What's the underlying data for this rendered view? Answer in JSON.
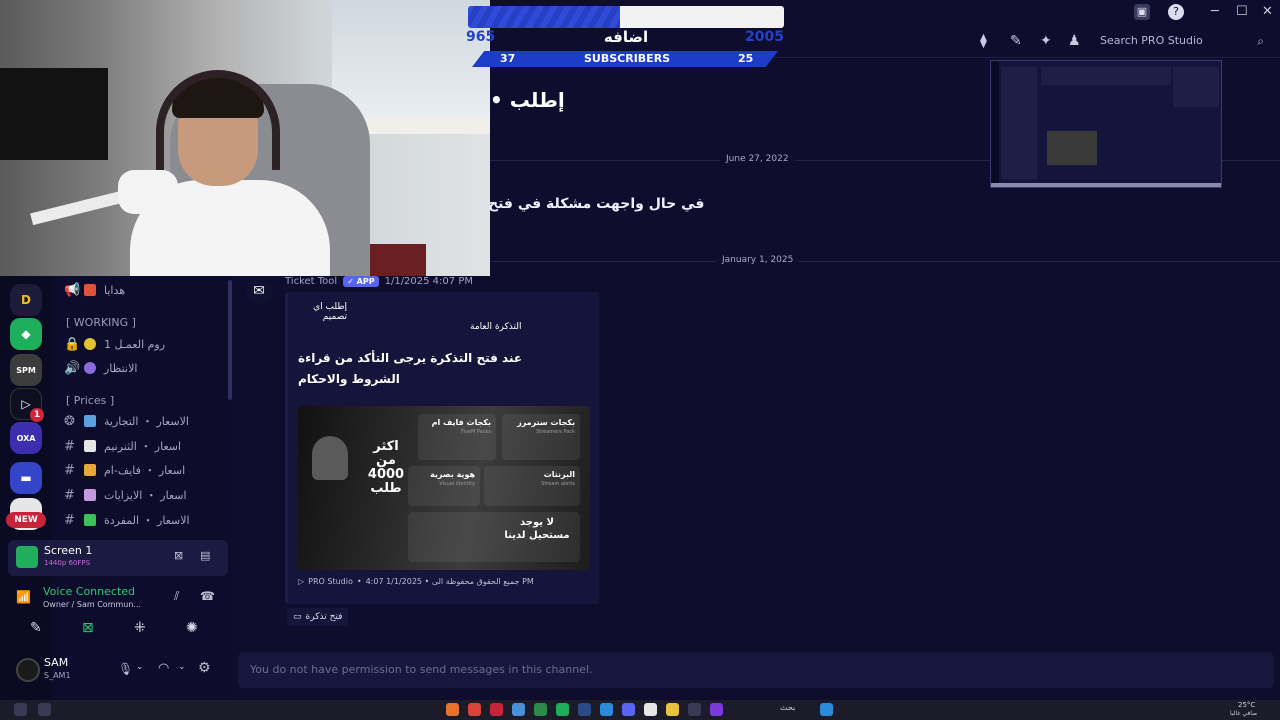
{
  "window": {
    "search_placeholder": "Search PRO Studio",
    "controls": [
      "─",
      "☐",
      "✕"
    ]
  },
  "subscriber_widget": {
    "left_count": "965",
    "right_count": "2005",
    "title": "اضافه",
    "band_left": "37",
    "band_center": "SUBSCRIBERS",
    "band_right": "25",
    "progress_fraction": 0.48,
    "fill_color": "#2f4bd8"
  },
  "servers": [
    {
      "icon": "D",
      "color": "#1d1b3a"
    },
    {
      "icon": "◆",
      "color": "#1fae5b"
    },
    {
      "icon": "SPM",
      "color": "#3c3c3c"
    },
    {
      "icon": "▷",
      "color": "#0f0f22",
      "badge": "1"
    },
    {
      "icon": "OXA",
      "color": "#3b2fb0"
    },
    {
      "icon": "▬",
      "color": "#3445c9"
    },
    {
      "icon": "",
      "color": "#e6e6e6"
    }
  ],
  "new_badge": "NEW",
  "channels": {
    "items_top": [
      {
        "label": "هدايا",
        "icon_color": "#e0523a"
      }
    ],
    "cat_working": "[ WORKING ]",
    "working": [
      {
        "label": "روم العمـل 1",
        "icon": "🔒",
        "icon_color": "#e6c233"
      },
      {
        "label": "الانتظار",
        "icon": "🔊",
        "icon_color": "#8b6bd9"
      }
    ],
    "cat_prices": "[ Prices ]",
    "prices": [
      {
        "label": "الاسعار ・ التجارية",
        "icon_color": "#5aa1df"
      },
      {
        "label": "اسعار ・ الثنرنيم",
        "icon_color": "#e6e6e6"
      },
      {
        "label": "اسعار ・ فايف-ام",
        "icon_color": "#e8a73a"
      },
      {
        "label": "اسعار ・ الايزايات",
        "icon_color": "#c49adf"
      },
      {
        "label": "الاسعار ・ المفردة",
        "icon_color": "#3fbf5a"
      }
    ]
  },
  "screen_share": {
    "title": "Screen 1",
    "subtitle": "1440p 60FPS"
  },
  "voice": {
    "status": "Voice Connected",
    "channel": "Owner / Sam Commun..."
  },
  "user": {
    "name": "SAM",
    "tag": "S_AM1"
  },
  "messages": {
    "big_text": "• إطلب",
    "date1": "June 27, 2022",
    "mid_text": "في حال واجهت مشكلة في فتح",
    "date2": "January 1, 2025"
  },
  "embed": {
    "bot_name": "Ticket Tool",
    "app_badge": "✓ APP",
    "timestamp": "1/1/2025 4:07 PM",
    "line1": "إطلب اي تصميم",
    "line2": "التذكرة العامة",
    "line3": "عند فتح التذكرة يرجى التأكد من قراءة الشروط والاحكام",
    "banner": {
      "big": "اكثر من 4000 طلب",
      "tile1": "بكجات سترمرز",
      "tile1_sub": "Streamers Pack",
      "tile2": "بكجات فايف ام",
      "tile2_sub": "FiveM Packs",
      "tile3": "البرنتات",
      "tile3_sub": "Stream alerts",
      "tile4": "هوية بصرية",
      "tile4_sub": "Visual Identity",
      "noreq": "لا يوجد مستحيل لدينا"
    },
    "footer_brand": "PRO Studio",
    "footer_text": "4:07 1/1/2025 • جميع الحقوق محفوظة الى PM",
    "button_label": "فتح تذكرة"
  },
  "composer_placeholder": "You do not have permission to send messages in this channel.",
  "taskbar": {
    "search_label": "بحث",
    "weather": "25°C",
    "weather_sub": "صافي غالبا"
  }
}
